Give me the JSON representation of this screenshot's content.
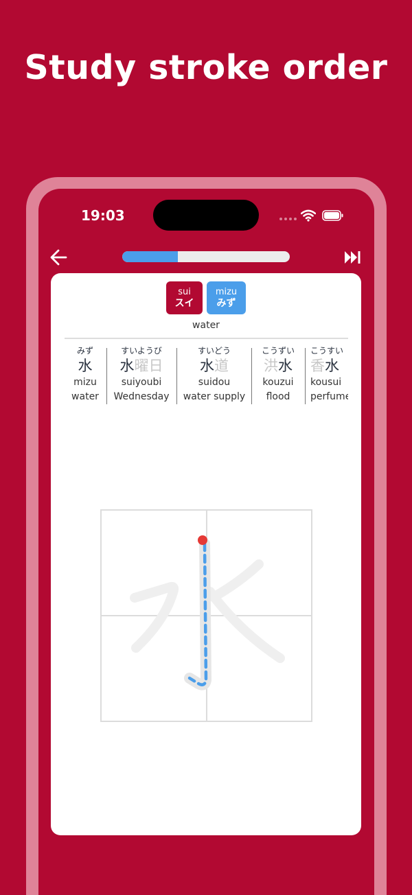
{
  "headline": "Study stroke order",
  "status_bar": {
    "time": "19:03"
  },
  "lesson_progress": 0.33,
  "readings": [
    {
      "romaji": "sui",
      "kana": "スイ",
      "type": "on",
      "color": "#b20932"
    },
    {
      "romaji": "mizu",
      "kana": "みず",
      "type": "kun",
      "color": "#4b9eea"
    }
  ],
  "meaning": "water",
  "kanji": "水",
  "vocab": [
    {
      "furigana": "みず",
      "word": "水",
      "dim": "",
      "romaji": "mizu",
      "english": "water"
    },
    {
      "furigana": "すいようび",
      "word": "水",
      "dim": "曜日",
      "romaji": "suiyoubi",
      "english": "Wednesday"
    },
    {
      "furigana": "すいどう",
      "word": "水",
      "dim": "道",
      "romaji": "suidou",
      "english": "water supply"
    },
    {
      "furigana": "こうずい",
      "word": "水",
      "dim": "洪",
      "romaji": "kouzui",
      "english": "flood"
    },
    {
      "furigana": "こうすい",
      "word": "水",
      "dim": "香",
      "romaji": "kousui",
      "english": "perfume"
    }
  ],
  "icons": {
    "back": "arrow-left-icon",
    "skip": "skip-forward-icon",
    "wifi": "wifi-icon",
    "battery": "battery-icon"
  },
  "colors": {
    "brand": "#b20932",
    "accent": "#4b9eea",
    "stroke_start": "#e53935",
    "ghost_stroke": "#efefef"
  }
}
